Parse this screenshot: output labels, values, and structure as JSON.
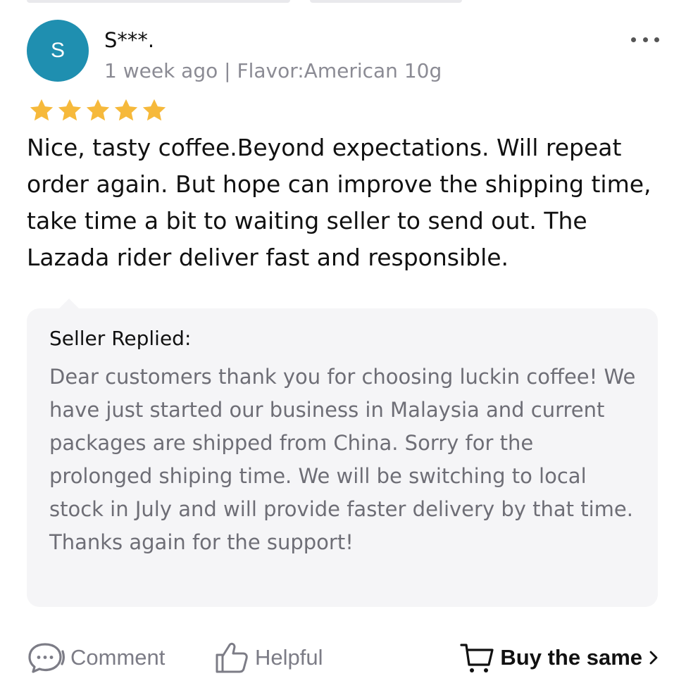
{
  "review": {
    "avatar_initial": "S",
    "username": "S***.",
    "meta": "1 week ago | Flavor:American 10g",
    "rating": 5,
    "rating_max": 5,
    "text": "Nice, tasty coffee.Beyond expectations. Will repeat order again. But hope can improve the shipping time, take time a bit to waiting seller to send out. The Lazada rider deliver fast and responsible."
  },
  "reply": {
    "title": "Seller Replied:",
    "text": "Dear customers thank you for choosing luckin coffee! We have just started our business in Malaysia and current packages are shipped from China. Sorry for the prolonged shiping time. We will be switching to local stock in July and will provide faster delivery by that time. Thanks again for the support!"
  },
  "actions": {
    "comment_label": "Comment",
    "helpful_label": "Helpful",
    "buy_label": "Buy the same"
  },
  "icons": {
    "more": "more-dots-icon",
    "star": "star-icon",
    "comment": "chat-bubble-icon",
    "helpful": "thumbs-up-icon",
    "cart": "cart-icon",
    "chevron": "chevron-right-icon"
  },
  "colors": {
    "avatar_bg": "#1f8fb0",
    "star": "#f6b93b",
    "muted_text": "#8b8b94",
    "reply_bg": "#f5f5f7"
  }
}
